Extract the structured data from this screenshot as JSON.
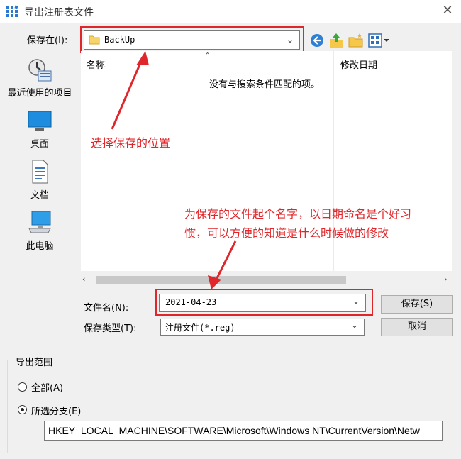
{
  "window": {
    "title": "导出注册表文件",
    "close_glyph": "✕"
  },
  "save_in": {
    "label": "保存在(I):",
    "value": "BackUp"
  },
  "places": [
    {
      "label": "最近使用的项目",
      "icon": "recent-places-icon"
    },
    {
      "label": "桌面",
      "icon": "desktop-icon"
    },
    {
      "label": "文档",
      "icon": "documents-icon"
    },
    {
      "label": "此电脑",
      "icon": "this-pc-icon"
    }
  ],
  "file_list": {
    "columns": [
      "名称",
      "修改日期"
    ],
    "empty_message": "没有与搜索条件匹配的项。"
  },
  "filename": {
    "label": "文件名(N):",
    "value": "2021-04-23"
  },
  "filetype": {
    "label": "保存类型(T):",
    "value": "注册文件(*.reg)"
  },
  "buttons": {
    "save": "保存(S)",
    "cancel": "取消"
  },
  "export_range": {
    "title": "导出范围",
    "option_all": "全部(A)",
    "option_branch": "所选分支(E)",
    "selected": "branch",
    "branch_path": "HKEY_LOCAL_MACHINE\\SOFTWARE\\Microsoft\\Windows NT\\CurrentVersion\\Netw"
  },
  "annotations": {
    "folder_note": "选择保存的位置",
    "name_note_line1": "为保存的文件起个名字，以日期命名是个好习",
    "name_note_line2": "惯，可以方便的知道是什么时候做的修改",
    "color": "#e0262a"
  }
}
